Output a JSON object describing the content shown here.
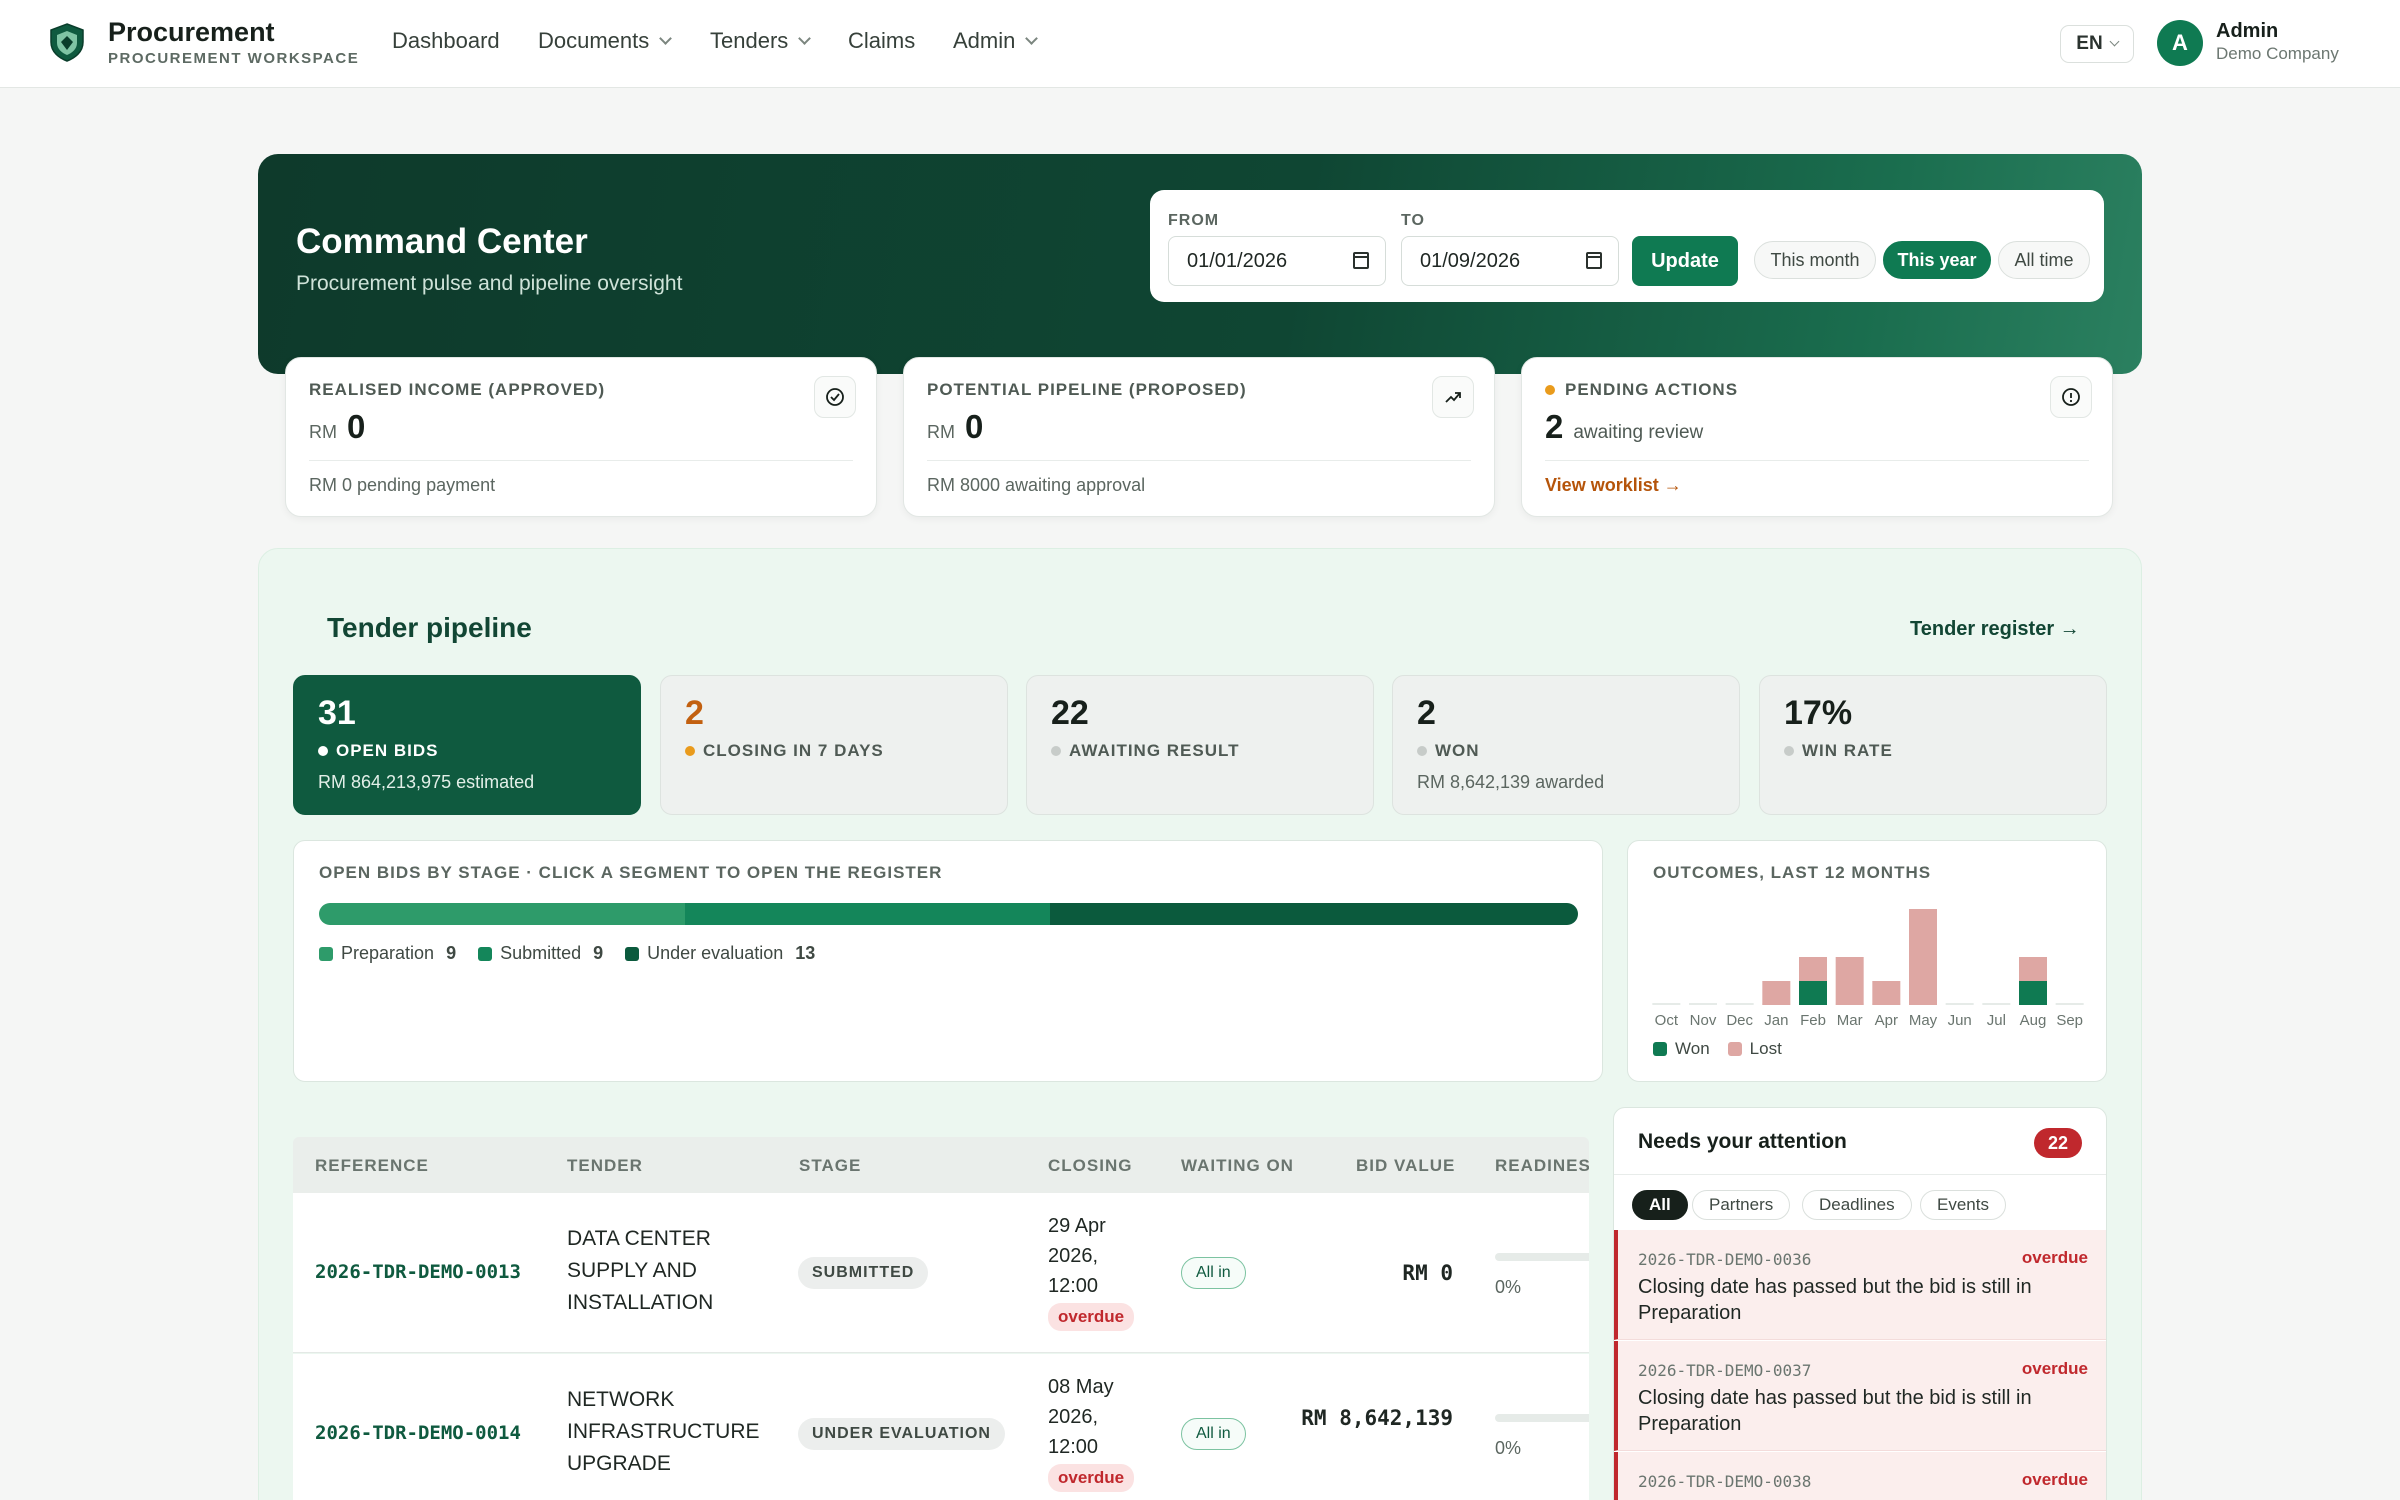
{
  "nav": {
    "brand_title": "Procurement",
    "brand_sub": "PROCUREMENT WORKSPACE",
    "items": [
      {
        "label": "Dashboard"
      },
      {
        "label": "Documents"
      },
      {
        "label": "Tenders"
      },
      {
        "label": "Claims"
      },
      {
        "label": "Admin"
      }
    ],
    "lang": "EN",
    "avatar_initial": "A",
    "user_name": "Admin",
    "user_company": "Demo Company"
  },
  "hero": {
    "title": "Command Center",
    "subtitle": "Procurement pulse and pipeline oversight",
    "from_label": "FROM",
    "to_label": "TO",
    "from_value": "01/01/2026",
    "to_value": "01/09/2026",
    "update_label": "Update",
    "ranges": [
      "This month",
      "This year",
      "All time"
    ],
    "active_range": "This year"
  },
  "kpis": [
    {
      "label": "REALISED INCOME (APPROVED)",
      "currency": "RM",
      "value": "0",
      "foot": "RM 0 pending payment",
      "icon": "check-circle-icon"
    },
    {
      "label": "POTENTIAL PIPELINE (PROPOSED)",
      "currency": "RM",
      "value": "0",
      "foot": "RM 8000 awaiting approval",
      "icon": "trend-up-icon"
    },
    {
      "label": "PENDING ACTIONS",
      "value": "2",
      "value_text": "awaiting review",
      "foot": "View worklist →",
      "icon": "alert-circle-icon"
    }
  ],
  "pipeline": {
    "title": "Tender pipeline",
    "register_link": "Tender register →",
    "stats": [
      {
        "value": "31",
        "label": "OPEN BIDS",
        "note": "RM 864,213,975 estimated",
        "dot": "#ffffff"
      },
      {
        "value": "2",
        "label": "CLOSING IN 7 DAYS",
        "note": "",
        "dot": "#e99b1c",
        "value_color": "#c2600f"
      },
      {
        "value": "22",
        "label": "AWAITING RESULT",
        "note": "",
        "dot": "#c7ccc9"
      },
      {
        "value": "2",
        "label": "WON",
        "note": "RM 8,642,139 awarded",
        "dot": "#c7ccc9"
      },
      {
        "value": "17%",
        "label": "WIN RATE",
        "note": "",
        "dot": "#c7ccc9"
      }
    ],
    "stage_title": "OPEN BIDS BY STAGE · CLICK A SEGMENT TO OPEN THE REGISTER",
    "stages": [
      {
        "name": "Preparation",
        "count": 9,
        "color": "#2e9b6a"
      },
      {
        "name": "Submitted",
        "count": 9,
        "color": "#14865a"
      },
      {
        "name": "Under evaluation",
        "count": 13,
        "color": "#0b5a3d"
      }
    ]
  },
  "chart_data": {
    "type": "bar",
    "title": "OUTCOMES, LAST 12 MONTHS",
    "categories": [
      "Oct",
      "Nov",
      "Dec",
      "Jan",
      "Feb",
      "Mar",
      "Apr",
      "May",
      "Jun",
      "Jul",
      "Aug",
      "Sep"
    ],
    "series": [
      {
        "name": "Won",
        "color": "#0f7a52",
        "values": [
          0,
          0,
          0,
          0,
          1,
          0,
          0,
          0,
          0,
          0,
          1,
          0
        ]
      },
      {
        "name": "Lost",
        "color": "#dea7a3",
        "values": [
          0,
          0,
          0,
          1,
          1,
          2,
          1,
          4,
          0,
          0,
          1,
          0
        ]
      }
    ],
    "stacked": true,
    "legend": "bottom-left"
  },
  "table": {
    "headers": [
      "REFERENCE",
      "TENDER",
      "STAGE",
      "CLOSING",
      "WAITING ON",
      "BID VALUE",
      "READINESS"
    ],
    "rows": [
      {
        "ref": "2026-TDR-DEMO-0013",
        "tender": "DATA CENTER SUPPLY AND INSTALLATION",
        "stage": "SUBMITTED",
        "closing_date": "29 Apr 2026,",
        "closing_time": "12:00",
        "closing_tag": "overdue",
        "waiting": "All in",
        "bid": "RM 0",
        "readiness": "0%"
      },
      {
        "ref": "2026-TDR-DEMO-0014",
        "tender": "NETWORK INFRASTRUCTURE UPGRADE",
        "stage": "UNDER EVALUATION",
        "closing_date": "08 May 2026,",
        "closing_time": "12:00",
        "closing_tag": "overdue",
        "waiting": "All in",
        "bid": "RM 8,642,139",
        "readiness": "0%"
      }
    ]
  },
  "attention": {
    "title": "Needs your attention",
    "count": "22",
    "filters": [
      "All",
      "Partners",
      "Deadlines",
      "Events"
    ],
    "items": [
      {
        "ref": "2026-TDR-DEMO-0036",
        "status": "overdue",
        "text": "Closing date has passed but the bid is still in Preparation"
      },
      {
        "ref": "2026-TDR-DEMO-0037",
        "status": "overdue",
        "text": "Closing date has passed but the bid is still in Preparation"
      },
      {
        "ref": "2026-TDR-DEMO-0038",
        "status": "overdue",
        "text": ""
      }
    ]
  }
}
